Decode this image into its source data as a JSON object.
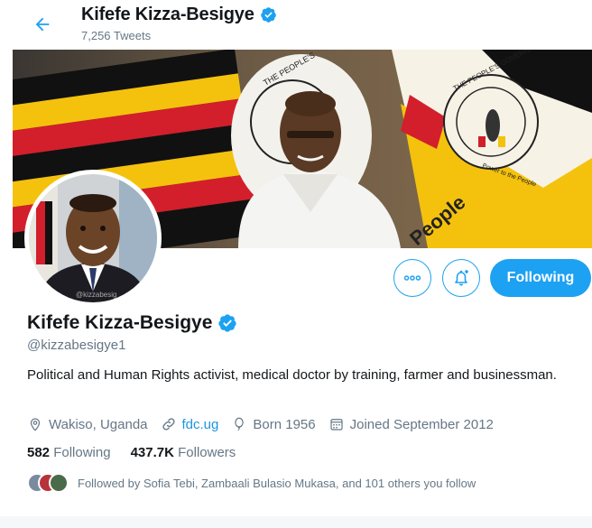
{
  "header": {
    "name": "Kifefe Kizza-Besigye",
    "tweet_count": "7,256 Tweets",
    "back_icon": "arrow-left-icon",
    "verified_icon": "verified-badge-icon"
  },
  "banner": {
    "flag_text_1": "THE PEOPLE'S",
    "flag_text_2": "THE PEOPLE'S GOVERNMENT",
    "flag_text_3": "Power to the People",
    "flag_text_4": "People"
  },
  "avatar": {
    "caption": "@kizzabesig"
  },
  "actions": {
    "more_icon": "more-horizontal-icon",
    "notify_icon": "bell-plus-icon",
    "follow_label": "Following"
  },
  "profile": {
    "name": "Kifefe Kizza-Besigye",
    "handle": "@kizzabesigye1",
    "bio": "Political and Human Rights activist, medical doctor by training, farmer and businessman.",
    "location": "Wakiso, Uganda",
    "website": "fdc.ug",
    "born": "Born 1956",
    "joined": "Joined September 2012"
  },
  "stats": {
    "following_count": "582",
    "following_label": "Following",
    "followers_count": "437.7K",
    "followers_label": "Followers"
  },
  "followed_by": {
    "text": "Followed by Sofia Tebi, Zambaali Bulasio Mukasa, and 101 others you follow"
  },
  "colors": {
    "accent": "#1da1f2",
    "link": "#1b95e0",
    "muted": "#657786",
    "text": "#14171a"
  }
}
